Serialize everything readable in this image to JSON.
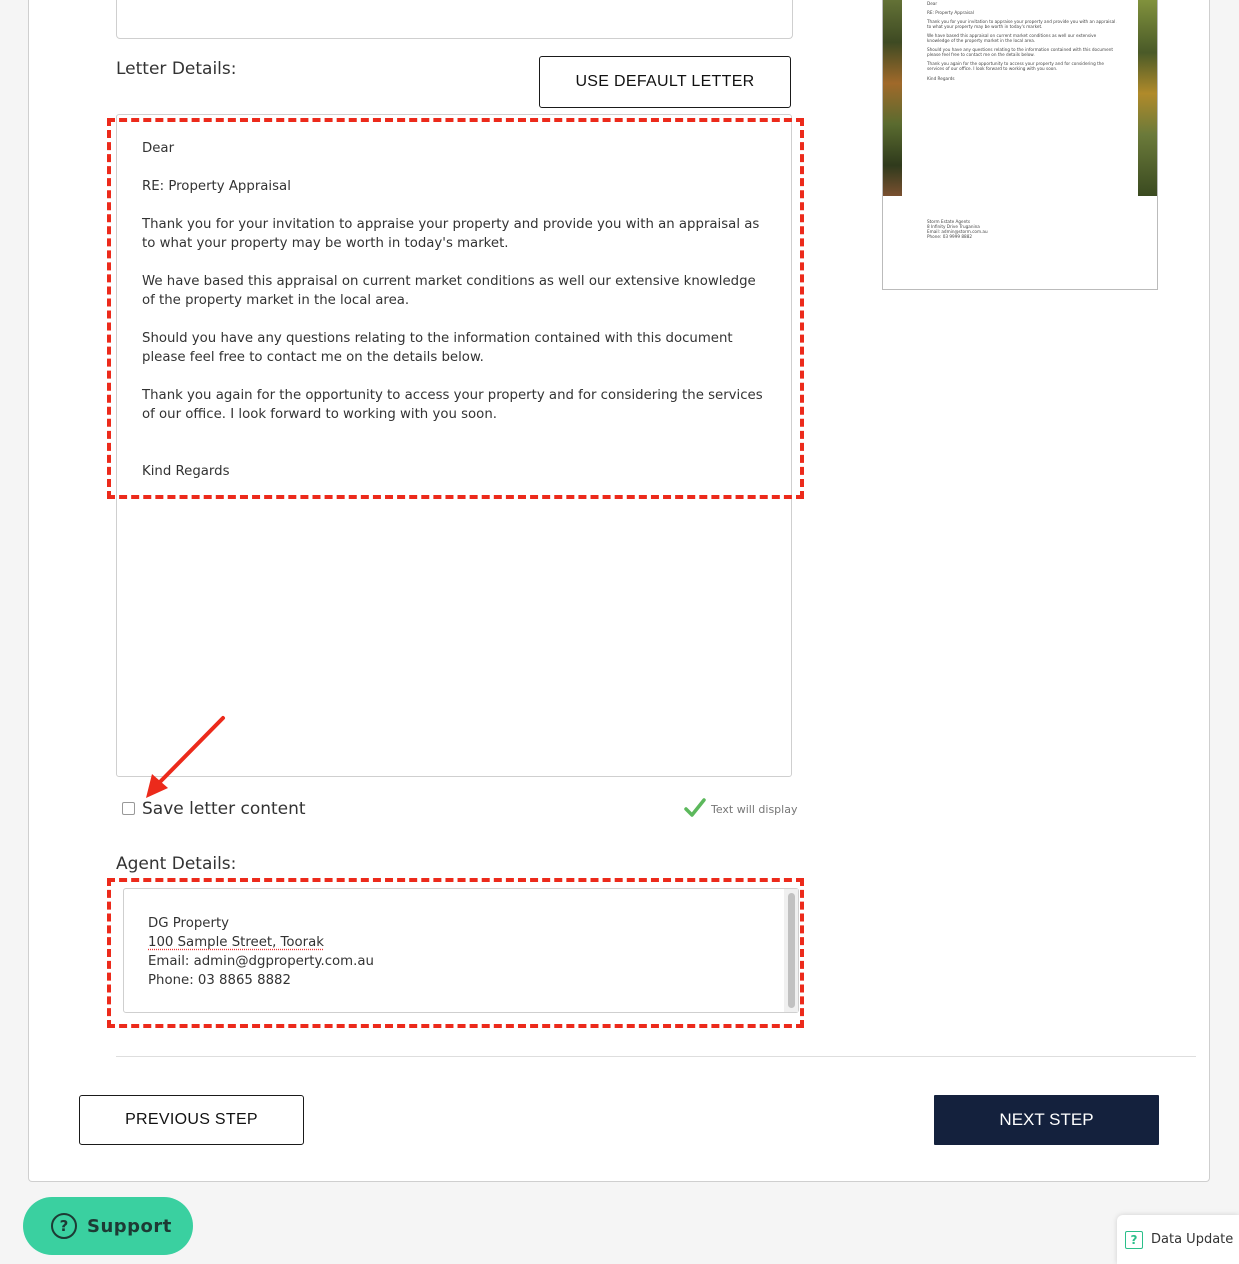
{
  "letter_details": {
    "label": "Letter Details:",
    "use_default_button": "USE DEFAULT LETTER",
    "lines": [
      "Dear",
      "RE: Property Appraisal",
      "Thank you for your invitation to appraise your property and provide you with an appraisal as to what your property may be worth in today's market.",
      "We have based this appraisal on current market conditions as well our extensive knowledge of the property market in the local area.",
      "Should you have any questions relating to the information contained with this document please feel free to contact me on the details below.",
      "Thank you again for the opportunity to access your property and for considering the services of our office. I look forward to working with you soon.",
      "Kind Regards"
    ]
  },
  "save_letter": {
    "label": "Save letter content",
    "checked": false
  },
  "text_display": {
    "label": "Text will display",
    "icon": "check-icon",
    "color": "#5cb85c"
  },
  "agent_details": {
    "label": "Agent Details:",
    "lines": [
      "DG Property",
      "100 Sample Street, Toorak",
      "Email: admin@dgproperty.com.au",
      "Phone: 03 8865 8882"
    ]
  },
  "navigation": {
    "previous_label": "PREVIOUS STEP",
    "next_label": "NEXT STEP",
    "next_color": "#14213d"
  },
  "preview": {
    "lines": [
      "Dear",
      "RE: Property Appraisal",
      "Thank you for your invitation to appraise your property and provide you with an appraisal as",
      "to what your property may be worth in today's market.",
      "We have based this appraisal on current market conditions as well our extensive",
      "knowledge of the property market in the local area.",
      "Should you have any questions relating to the information contained with this document",
      "please feel free to contact me on the details below.",
      "Thank you again for the opportunity to access your property and for considering the",
      "services of our office. I look forward to working with you soon.",
      "Kind Regards"
    ],
    "footer_lines": [
      "Storm Estate Agents",
      "8 Infinity Drive Truganina",
      "Email: admin@storm.com.au",
      "Phone: 03 9999 8882"
    ]
  },
  "support": {
    "label": "Support",
    "color": "#3ad0a0"
  },
  "data_update": {
    "label": "Data Update"
  },
  "colors": {
    "annotation": "#ec2a1b",
    "accent": "#2bbf8a"
  }
}
